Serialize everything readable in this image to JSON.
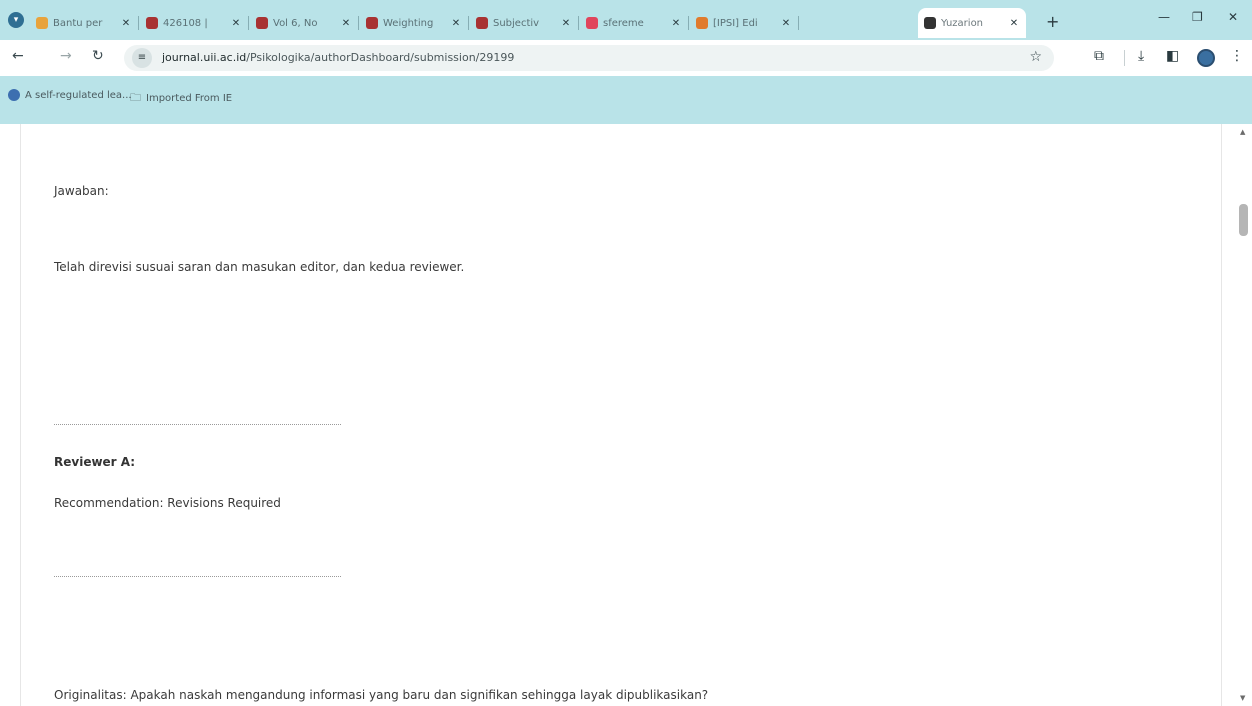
{
  "tabs": [
    {
      "label": "Bantu per",
      "favicon_color": "#e8a33c"
    },
    {
      "label": "426108 |",
      "favicon_color": "#a83232"
    },
    {
      "label": "Vol 6, No",
      "favicon_color": "#a83232"
    },
    {
      "label": "Weighting",
      "favicon_color": "#a83232"
    },
    {
      "label": "Subjectiv",
      "favicon_color": "#a83232"
    },
    {
      "label": "sfereme",
      "favicon_color": "#e0455c"
    },
    {
      "label": "[IPSI] Edi",
      "favicon_color": "#e07b2d"
    },
    {
      "label": "Yuzarion",
      "favicon_color": "#333333",
      "active": true
    }
  ],
  "address_bar": {
    "host": "journal.uii.ac.id",
    "path": "/Psikologika/authorDashboard/submission/29199"
  },
  "bookmarks": [
    {
      "label": "A self-regulated lea...",
      "icon": "globe-icon"
    },
    {
      "label": "Imported From IE",
      "icon": "folder-icon"
    }
  ],
  "content": {
    "jawaban_label": "Jawaban:",
    "jawaban_text": "Telah direvisi susuai saran dan masukan editor, dan kedua reviewer.",
    "reviewer_heading": "Reviewer A:",
    "recommendation": "Recommendation: Revisions Required",
    "originalitas_question": "Originalitas: Apakah naskah mengandung informasi yang baru dan signifikan sehingga layak dipublikasikan?"
  },
  "colors": {
    "chrome_frame": "#b9e3e8",
    "page_background": "#ffffff",
    "body_text": "#3a3a3a"
  }
}
